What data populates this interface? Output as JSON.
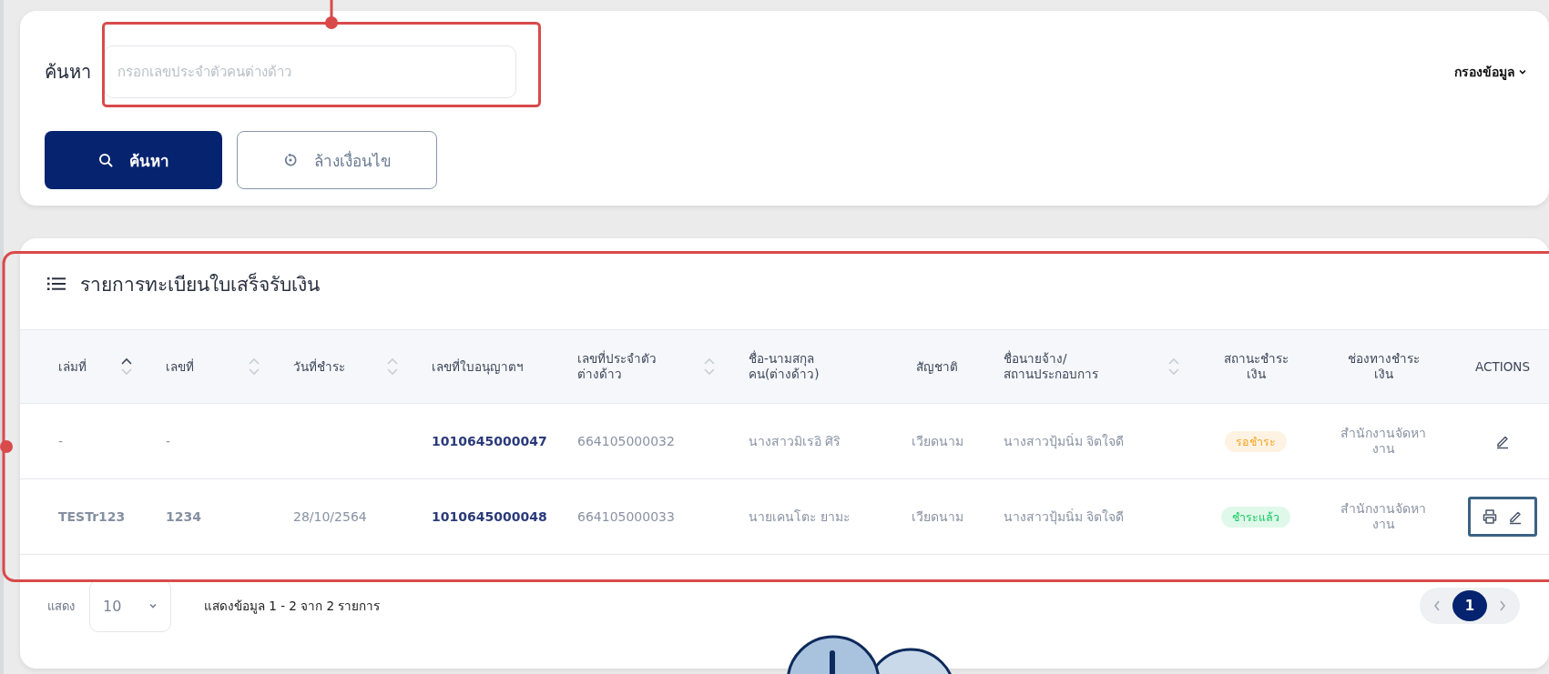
{
  "search": {
    "label": "ค้นหา",
    "placeholder": "กรอกเลขประจำตัวคนต่างด้าว",
    "highlighted": true,
    "filter_label": "กรองข้อมูล"
  },
  "buttons": [
    {
      "kind": "primary",
      "label": "ค้นหา"
    },
    {
      "kind": "outline",
      "label": "ล้างเงื่อนไข"
    }
  ],
  "table": {
    "title": "รายการทะเบียนใบเสร็จรับเงิน",
    "highlighted": true,
    "columns": [
      {
        "label": "เล่มที่",
        "sortable": true,
        "sorted_ascending": true
      },
      {
        "label": "เลขที่",
        "sortable": true,
        "sorted_ascending": false
      },
      {
        "label": "วันที่ชำระ",
        "sortable": true,
        "sorted_ascending": false
      },
      {
        "label": "เลขที่ใบอนุญาตฯ",
        "sortable": false
      },
      {
        "label": "เลขที่ประจำตัว\nต่างด้าว",
        "sortable": true,
        "sorted_ascending": false
      },
      {
        "label": "ชื่อ-นามสกุล\nคน(ต่างด้าว)",
        "sortable": false
      },
      {
        "label": "สัญชาติ",
        "sortable": false
      },
      {
        "label": "ชื่อนายจ้าง/\nสถานประกอบการ",
        "sortable": true,
        "sorted_ascending": false
      },
      {
        "label": "สถานะชำระ\nเงิน",
        "sortable": false
      },
      {
        "label": "ช่องทางชำระ\nเงิน",
        "sortable": false
      },
      {
        "label": "ACTIONS",
        "sortable": false
      }
    ],
    "rows": [
      {
        "book": "-",
        "number": "-",
        "license": "1010645000047",
        "alien_id": "664105000032",
        "name": "นางสาวมิเรอิ ศิริ",
        "nationality": "เวียดนาม",
        "employer": "นางสาวปุ้มนิ่ม จิตใจดี",
        "status": {
          "label": "รอชำระ",
          "color": "#f5a524"
        },
        "channel": "สำนักงานจัดหา\nงาน",
        "printable": false,
        "editable": true,
        "actions_highlighted": false
      },
      {
        "book": "TESTr123",
        "number": "1234",
        "paid_date": "28/10/2564",
        "license": "1010645000048",
        "alien_id": "664105000033",
        "name": "นายเคนโตะ ยามะ",
        "nationality": "เวียดนาม",
        "employer": "นางสาวปุ้มนิ่ม จิตใจดี",
        "status": {
          "label": "ชำระแล้ว",
          "color": "#17c964"
        },
        "channel": "สำนักงานจัดหา\nงาน",
        "printable": true,
        "editable": true,
        "actions_highlighted": true
      }
    ]
  },
  "footer": {
    "show_label": "แสดง",
    "page_size": "10",
    "summary": "แสดงข้อมูล 1 - 2 จาก 2 รายการ",
    "pages": [
      {
        "label": "1",
        "selected": true
      }
    ]
  }
}
